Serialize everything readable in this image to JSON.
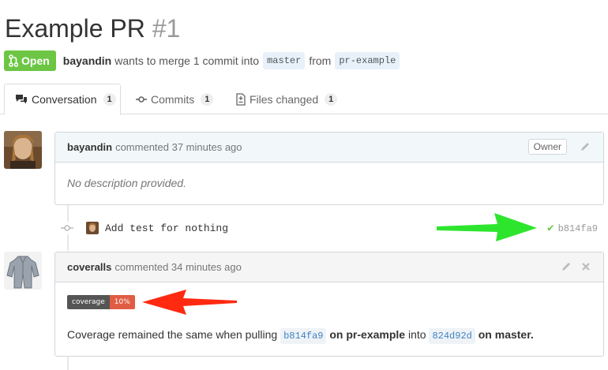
{
  "pr": {
    "title": "Example PR",
    "number": "#1",
    "state_label": "Open",
    "author": "bayandin",
    "summary": "wants to merge 1 commit into",
    "base_branch": "master",
    "from_word": "from",
    "head_branch": "pr-example"
  },
  "tabs": [
    {
      "label": "Conversation",
      "count": "1"
    },
    {
      "label": "Commits",
      "count": "1"
    },
    {
      "label": "Files changed",
      "count": "1"
    }
  ],
  "comments": [
    {
      "author": "bayandin",
      "meta": "commented 37 minutes ago",
      "role": "Owner",
      "body": "No description provided."
    },
    {
      "author": "coveralls",
      "meta": "commented 34 minutes ago",
      "badge": {
        "label": "coverage",
        "value": "10%",
        "color": "#e05d44"
      },
      "body": {
        "prefix": "Coverage remained the same when pulling",
        "sha": "b814fa9",
        "on_head": "on pr-example",
        "into_word": "into",
        "base_sha": "824d92d",
        "on_base": "on master."
      }
    }
  ],
  "commit": {
    "message": "Add test for nothing",
    "sha": "b814fa9",
    "status_icon": "check-icon"
  },
  "annotations": {
    "green_arrow_color": "#2ee52e",
    "red_arrow_color": "#ff2a10"
  },
  "colors": {
    "open_green": "#6cc644",
    "link_blue": "#4183c4"
  }
}
